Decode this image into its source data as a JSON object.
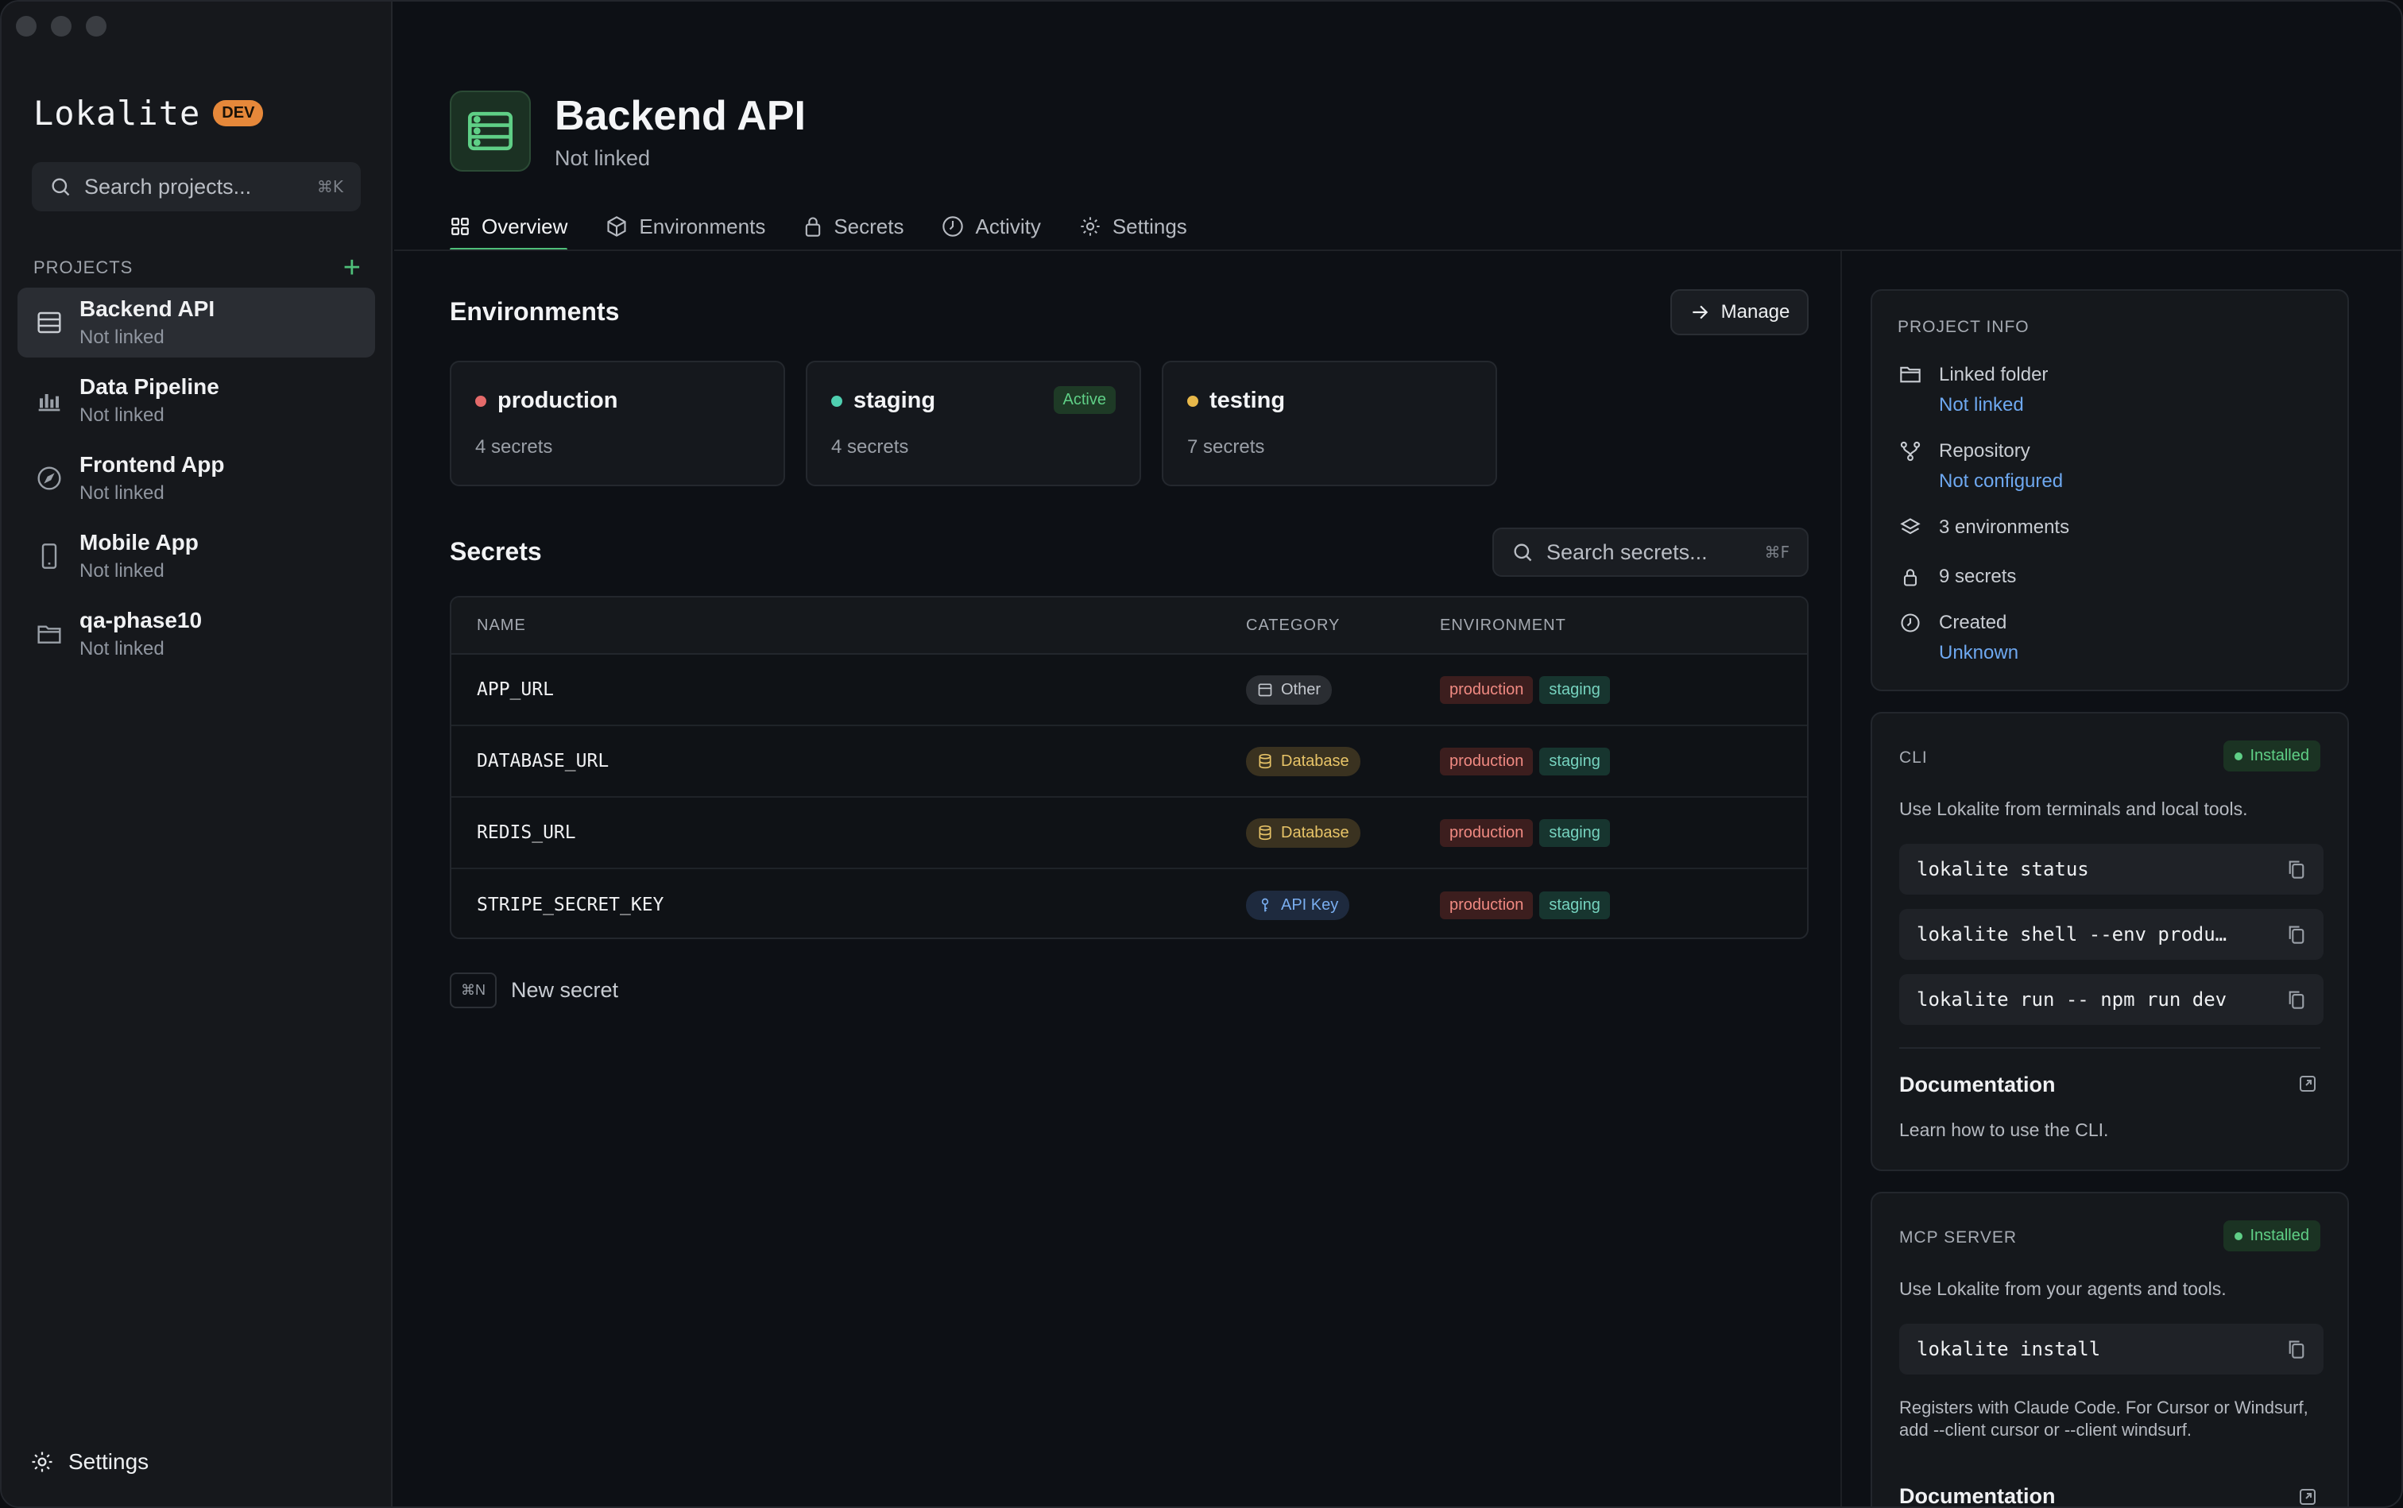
{
  "app": {
    "name": "Lokalite",
    "badge": "DEV"
  },
  "sidebar": {
    "search_placeholder": "Search projects...",
    "search_shortcut": "⌘K",
    "projects_label": "PROJECTS",
    "add_label": "+",
    "items": [
      {
        "name": "Backend API",
        "status": "Not linked",
        "icon": "server-icon",
        "active": true
      },
      {
        "name": "Data Pipeline",
        "status": "Not linked",
        "icon": "bar-chart-icon"
      },
      {
        "name": "Frontend App",
        "status": "Not linked",
        "icon": "compass-icon"
      },
      {
        "name": "Mobile App",
        "status": "Not linked",
        "icon": "phone-icon"
      },
      {
        "name": "qa-phase10",
        "status": "Not linked",
        "icon": "folder-icon"
      }
    ],
    "settings_label": "Settings"
  },
  "header": {
    "title": "Backend API",
    "subtitle": "Not linked"
  },
  "tabs": [
    {
      "label": "Overview",
      "icon": "grid-icon",
      "active": true
    },
    {
      "label": "Environments",
      "icon": "box-icon"
    },
    {
      "label": "Secrets",
      "icon": "lock-icon"
    },
    {
      "label": "Activity",
      "icon": "clock-icon"
    },
    {
      "label": "Settings",
      "icon": "gear-icon"
    }
  ],
  "environments": {
    "title": "Environments",
    "manage_label": "Manage",
    "items": [
      {
        "name": "production",
        "count": "4 secrets",
        "color": "#e46a6a"
      },
      {
        "name": "staging",
        "count": "4 secrets",
        "color": "#4fcfb0",
        "badge": "Active"
      },
      {
        "name": "testing",
        "count": "7 secrets",
        "color": "#e8b84a"
      }
    ]
  },
  "secrets": {
    "title": "Secrets",
    "search_placeholder": "Search secrets...",
    "search_shortcut": "⌘F",
    "columns": [
      "NAME",
      "CATEGORY",
      "ENVIRONMENT"
    ],
    "rows": [
      {
        "name": "APP_URL",
        "category": "Other",
        "category_icon": "calendar-icon",
        "envs": [
          "production",
          "staging"
        ]
      },
      {
        "name": "DATABASE_URL",
        "category": "Database",
        "category_icon": "database-icon",
        "envs": [
          "production",
          "staging"
        ]
      },
      {
        "name": "REDIS_URL",
        "category": "Database",
        "category_icon": "database-icon",
        "envs": [
          "production",
          "staging"
        ]
      },
      {
        "name": "STRIPE_SECRET_KEY",
        "category": "API Key",
        "category_icon": "key-icon",
        "envs": [
          "production",
          "staging"
        ]
      }
    ],
    "new_shortcut": "⌘N",
    "new_label": "New secret"
  },
  "project_info": {
    "title": "PROJECT INFO",
    "linked_folder_label": "Linked folder",
    "linked_folder_value": "Not linked",
    "repository_label": "Repository",
    "repository_value": "Not configured",
    "environments": "3 environments",
    "secrets": "9 secrets",
    "created_label": "Created",
    "created_value": "Unknown"
  },
  "cli": {
    "title": "CLI",
    "status": "Installed",
    "description": "Use Lokalite from terminals and local tools.",
    "commands": [
      "lokalite status",
      "lokalite shell --env produ…",
      "lokalite run -- npm run dev"
    ],
    "doc_title": "Documentation",
    "doc_desc": "Learn how to use the CLI."
  },
  "mcp": {
    "title": "MCP SERVER",
    "status": "Installed",
    "description": "Use Lokalite from your agents and tools.",
    "command": "lokalite install",
    "note": "Registers with Claude Code. For Cursor or Windsurf, add --client cursor or --client windsurf.",
    "doc_title": "Documentation"
  }
}
